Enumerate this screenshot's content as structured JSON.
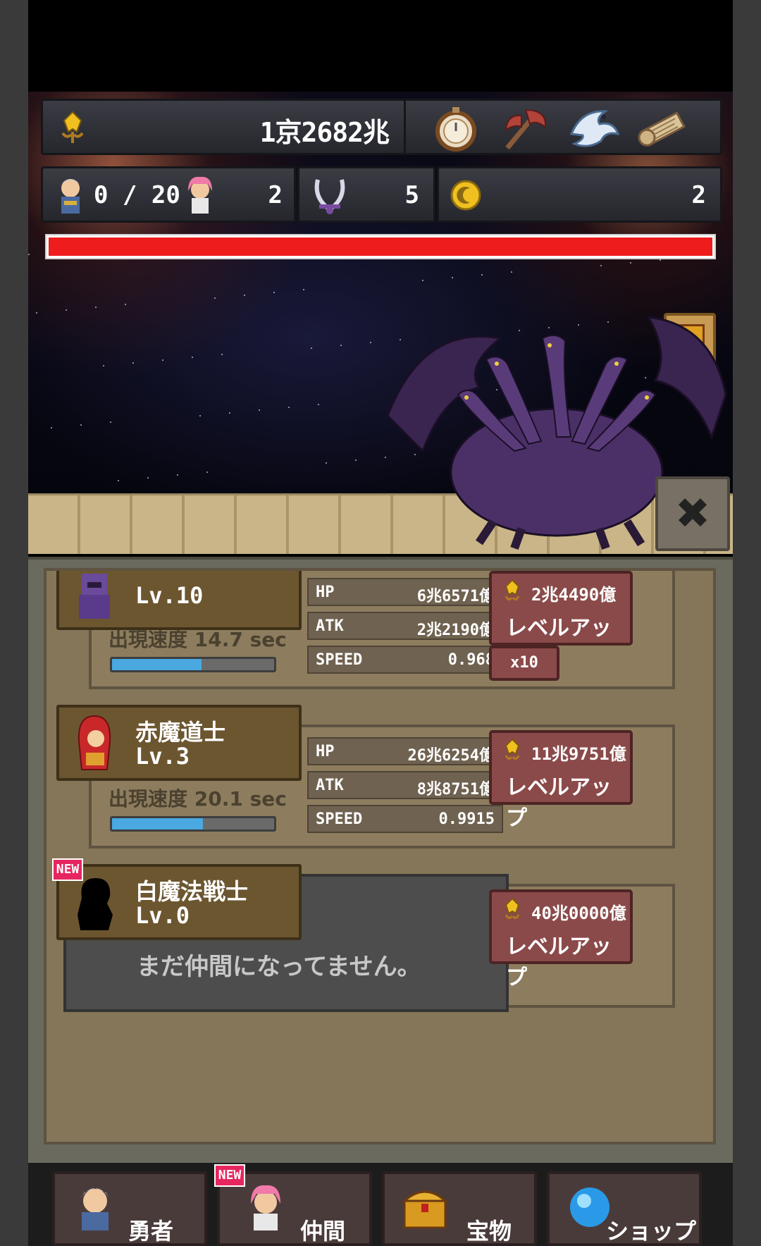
{
  "hud": {
    "gold": "1京2682兆",
    "party_count": "0 / 20",
    "allies_count": "2",
    "kills_count": "5",
    "coins_count": "2",
    "boss_hp_fraction": 1.0,
    "items": [
      "stopwatch-icon",
      "axe-icon",
      "white-dragon-icon",
      "scroll-icon"
    ]
  },
  "party": [
    {
      "name": "",
      "level": "Lv.10",
      "spawn_speed": "出現速度 14.7 sec",
      "spawn_fill": 0.55,
      "hp": "6兆6571億",
      "atk": "2兆2190億",
      "speed": "0.968",
      "cost": "2兆4490億",
      "levelup": "レベルアップ",
      "multiplier": "x10"
    },
    {
      "name": "赤魔道士",
      "level": "Lv.3",
      "spawn_speed": "出現速度 20.1 sec",
      "spawn_fill": 0.56,
      "hp": "26兆6254億",
      "atk": "8兆8751億",
      "speed": "0.9915",
      "cost": "11兆9751億",
      "levelup": "レベルアップ"
    },
    {
      "name": "白魔法戦士",
      "level": "Lv.0",
      "locked_text": "まだ仲間になってません。",
      "cost": "40兆0000億",
      "levelup": "レベルアップ",
      "badge": "NEW"
    }
  ],
  "stat_labels": {
    "hp": "HP",
    "atk": "ATK",
    "speed": "SPEED"
  },
  "tabs": [
    {
      "label": "勇者"
    },
    {
      "label": "仲間",
      "badge": "NEW"
    },
    {
      "label": "宝物"
    },
    {
      "label": "ショップ"
    }
  ],
  "colors": {
    "hp_bar": "#ee1c1c",
    "spawn_bar": "#49a9e0",
    "levelup": "#8b4a4a"
  }
}
